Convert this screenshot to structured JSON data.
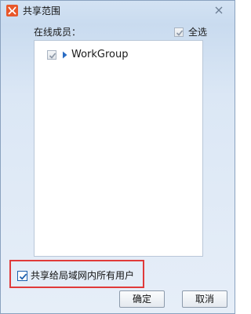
{
  "window": {
    "title": "共享范围",
    "icon": "app-logo-icon",
    "close_icon": "close-icon"
  },
  "members": {
    "label": "在线成员：",
    "select_all_label": "全选",
    "select_all_checked": true,
    "tree": [
      {
        "label": "WorkGroup",
        "checked": true,
        "expanded": false
      }
    ]
  },
  "share_lan": {
    "label": "共享给局域网内所有用户",
    "checked": true,
    "highlight_color": "#e03a3a"
  },
  "buttons": {
    "ok_label": "确定",
    "cancel_label": "取消"
  },
  "colors": {
    "accent": "#1c5fae",
    "titlebar_bg": "#d3e2f3"
  }
}
